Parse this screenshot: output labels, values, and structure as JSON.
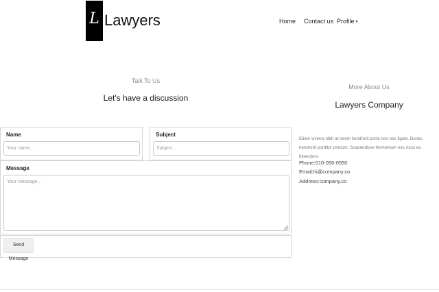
{
  "header": {
    "logo_letter": "L",
    "logo_text": "Lawyers",
    "nav": {
      "home": "Home",
      "contact": "Contact us",
      "profile": "Profile",
      "profile_caret": "▼"
    }
  },
  "contact_form": {
    "kicker": "Talk To Us",
    "heading": "Let's have a discussion",
    "name": {
      "label": "Name",
      "placeholder": "Your name..."
    },
    "subject": {
      "label": "Subject",
      "placeholder": "Subject..."
    },
    "message": {
      "label": "Message",
      "placeholder": "Your message..."
    },
    "send_label": "Send Message"
  },
  "about": {
    "kicker": "More About Us",
    "heading": "Lawyers Company",
    "paragraph": "Etiam viverra nibh at lorem hendrerit porta non nec ligula. Donec hendrerit porttitor pretium. Suspendisse fermentum nec risus eu bibendum.",
    "phone": "Phone:010-050-0550",
    "email": "Email:hi@company.co",
    "address": "Address:company.co"
  }
}
